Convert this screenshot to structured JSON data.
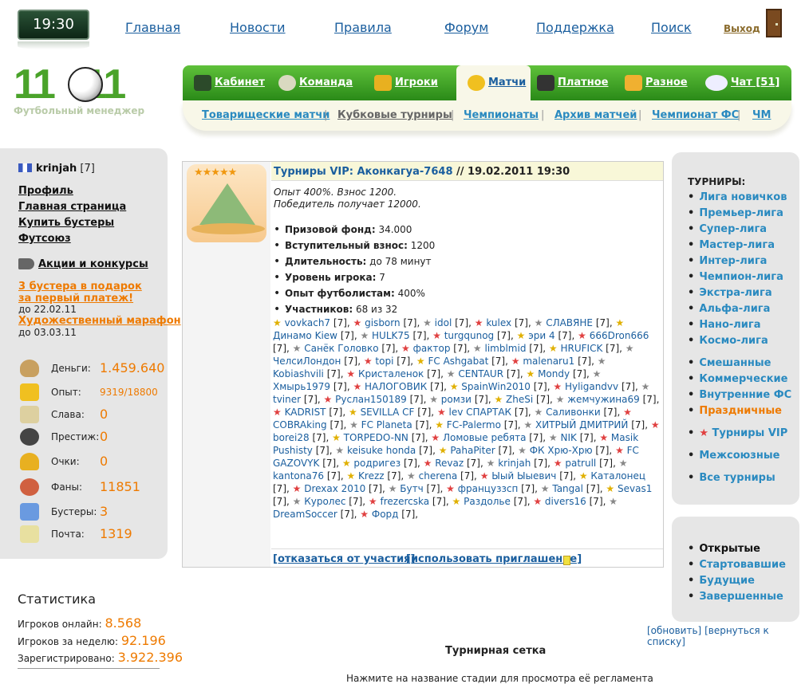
{
  "clock": "19:30",
  "topnav": [
    "Главная",
    "Новости",
    "Правила",
    "Форум",
    "Поддержка",
    "Поиск"
  ],
  "exit": "Выход",
  "logo": {
    "number": "11:11",
    "subtitle": "Футбольный менеджер"
  },
  "mainnav": [
    "Кабинет",
    "Команда",
    "Игроки",
    "Матчи",
    "Платное",
    "Разное",
    "Чат [51]"
  ],
  "subnav": [
    "Товарищеские матчи",
    "Кубковые турниры",
    "Чемпионаты",
    "Архив матчей",
    "Чемпионат ФС",
    "ЧМ"
  ],
  "user": {
    "name": "krinjah",
    "level": "[7]"
  },
  "left_links": [
    "Профиль",
    "Главная страница",
    "Купить бустеры",
    "Футсоюз"
  ],
  "promo": "Акции и конкурсы",
  "offer1": {
    "text": "3 бустера в подарок за первый платеж!",
    "until": "до 22.02.11"
  },
  "offer2": {
    "text": "Художественный марафон",
    "until": "до 03.03.11"
  },
  "stats": [
    {
      "label": "Деньги:",
      "value": "1.459.640",
      "icon": "money-bag-icon"
    },
    {
      "label": "Опыт:",
      "value": "9319/18800",
      "icon": "experience-icon"
    },
    {
      "label": "Слава:",
      "value": "0",
      "icon": "podium-icon"
    },
    {
      "label": "Престиж:",
      "value": "0",
      "icon": "prestige-icon"
    },
    {
      "label": "Очки:",
      "value": "0",
      "icon": "trophy-icon"
    },
    {
      "label": "Фаны:",
      "value": "11851",
      "icon": "fans-icon"
    },
    {
      "label": "Бустеры:",
      "value": "3",
      "icon": "gift-icon"
    },
    {
      "label": "Почта:",
      "value": "1319",
      "icon": "mail-icon"
    }
  ],
  "site_stats": {
    "title": "Статистика",
    "online_label": "Игроков онлайн:",
    "online": "8.568",
    "week_label": "Игроков за неделю:",
    "week": "92.196",
    "reg_label": "Зарегистрировано:",
    "reg": "3.922.396"
  },
  "tournament": {
    "stars": "★★★★★",
    "title": "Турниры VIP: Аконкагуа-7648",
    "date": " // 19.02.2011 19:30",
    "desc1": "Опыт 400%. Взнос 1200.",
    "desc2": "Победитель получает 12000.",
    "facts": [
      {
        "k": "Призовой фонд:",
        "v": " 34.000"
      },
      {
        "k": "Вступительный взнос:",
        "v": " 1200"
      },
      {
        "k": "Длительность:",
        "v": " до 78 минут"
      },
      {
        "k": "Уровень игрока:",
        "v": " 7"
      },
      {
        "k": "Опыт футболистам:",
        "v": " 400%"
      },
      {
        "k": "Участников:",
        "v": " 68 из 32"
      }
    ],
    "players": [
      "vovkach7",
      "gisborn",
      "idol",
      "kulex",
      "СЛАВЯНЕ",
      "Динамо Kiew",
      "HULK75",
      "turgqunog",
      "эри 4",
      "666Dron666",
      "Санёк Головко",
      "фактор",
      "limblmid",
      "HRUFICK",
      "ЧелсиЛондон",
      "topi",
      "FC Ashgabat",
      "malenaru1",
      "Kobiashvili",
      "Кристаленок",
      "CENTAUR",
      "Mondy",
      "Хмырь1979",
      "НАЛОГОВИК",
      "SpainWin2010",
      "Hyligandvv",
      "tviner",
      "Руслан150189",
      "ромзи",
      "ZheSi",
      "жемчужина69",
      "KADRIST",
      "SEVILLA CF",
      "lev СПАРТАК",
      "Саливонки",
      "COBRAking",
      "FC Planeta",
      "FC-Palermo",
      "ХИТРЫЙ ДМИТРИЙ",
      "borei28",
      "TORPEDO-NN",
      "Ломовые ребята",
      "NIK",
      "Masik Pushisty",
      "keisuke honda",
      "PahaPiter",
      "ФК Хрю-Хрю",
      "FC GAZOVYK",
      "родригез",
      "Revaz",
      "krinjah",
      "patrull",
      "kantona76",
      "Krezz",
      "cherena",
      "Ыый Ыыевич",
      "Каталонец",
      "Drexax 2010",
      "Бутч",
      "француззсп",
      "Tangal",
      "Sevas1",
      "Куролес",
      "frezercska",
      "Раздолье",
      "divers16",
      "DreamSoccer",
      "Форд"
    ],
    "level": "[7]",
    "decline": "[отказаться от участия]",
    "invite": "[использовать приглашение]"
  },
  "right": {
    "head": "ТУРНИРЫ:",
    "leagues": [
      "Лига новичков",
      "Премьер-лига",
      "Супер-лига",
      "Мастер-лига",
      "Интер-лига",
      "Чемпион-лига",
      "Экстра-лига",
      "Альфа-лига",
      "Нано-лига",
      "Космо-лига"
    ],
    "types": [
      "Смешанные",
      "Коммерческие",
      "Внутренние ФС",
      "Праздничные"
    ],
    "vip": "Турниры VIP",
    "inter": "Межсоюзные",
    "all": "Все турниры",
    "status_current": "Открытые",
    "status": [
      "Стартовавшие",
      "Будущие",
      "Завершенные"
    ]
  },
  "refresh": "[обновить]",
  "back": "[вернуться к списку]",
  "grid_title": "Турнирная сетка",
  "grid_note": "Нажмите на название стадии для просмотра её регламента"
}
